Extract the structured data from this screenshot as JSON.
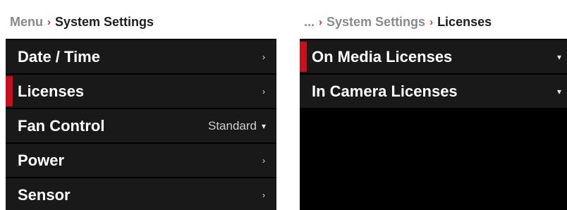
{
  "left_panel": {
    "breadcrumb": {
      "prev": "Menu",
      "separator": "›",
      "current": "System Settings"
    },
    "items": [
      {
        "label": "Date / Time",
        "value": "",
        "icon": "chevron-right-icon",
        "glyph": "›"
      },
      {
        "label": "Licenses",
        "value": "",
        "icon": "chevron-right-icon",
        "glyph": "›"
      },
      {
        "label": "Fan Control",
        "value": "Standard",
        "icon": "chevron-down-icon",
        "glyph": "▾"
      },
      {
        "label": "Power",
        "value": "",
        "icon": "chevron-right-icon",
        "glyph": "›"
      },
      {
        "label": "Sensor",
        "value": "",
        "icon": "chevron-right-icon",
        "glyph": "›"
      }
    ],
    "selected_index": 1
  },
  "right_panel": {
    "breadcrumb": {
      "prev": "...",
      "separator1": "›",
      "middle": "System Settings",
      "separator2": "›",
      "current": "Licenses"
    },
    "items": [
      {
        "label": "On Media Licenses",
        "icon": "chevron-down-icon",
        "glyph": "▾"
      },
      {
        "label": "In Camera Licenses",
        "icon": "chevron-down-icon",
        "glyph": "▾"
      }
    ],
    "selected_index": 0
  },
  "colors": {
    "accent": "#e3262e",
    "selection": "#c8101c",
    "row_background": "#191919",
    "screen_background": "#000000"
  }
}
